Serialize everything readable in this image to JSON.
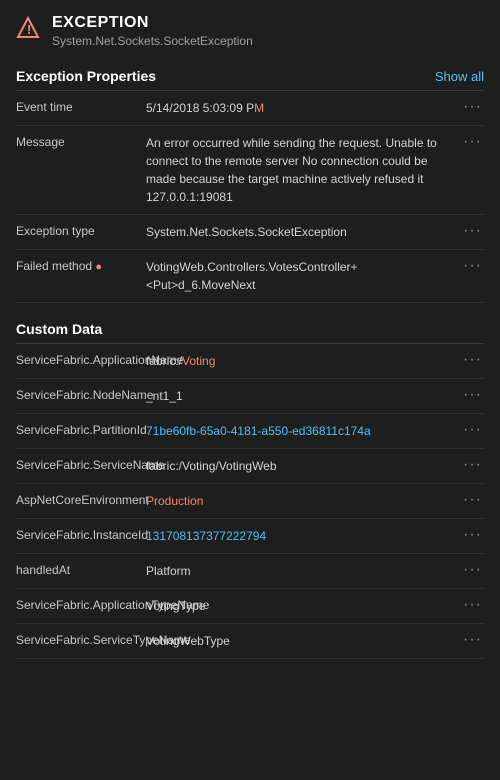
{
  "header": {
    "title": "EXCEPTION",
    "subtitle": "System.Net.Sockets.SocketException"
  },
  "exception_properties": {
    "section_title": "Exception Properties",
    "show_all_label": "Show all",
    "properties": [
      {
        "key": "Event time",
        "value": "5/14/2018 5:03:09 P",
        "highlight_suffix": "M",
        "link": false
      },
      {
        "key": "Message",
        "value": "An error occurred while sending the request. Unable to connect to the remote server No connection could be made because the target machine actively refused it 127.0.0.1:19081",
        "highlight_suffix": "",
        "link": false
      },
      {
        "key": "Exception type",
        "value": "System.Net.Sockets.SocketException",
        "highlight_suffix": "",
        "link": false
      },
      {
        "key": "Failed method",
        "value": "VotingWeb.Controllers.VotesController+<Put>d_6.MoveNext",
        "highlight_suffix": "",
        "link": false
      }
    ]
  },
  "custom_data": {
    "section_title": "Custom Data",
    "properties": [
      {
        "key": "ServiceFabric.ApplicationName",
        "value": "fabric:/Voting",
        "highlight_start": 8,
        "link": true
      },
      {
        "key": "ServiceFabric.NodeName",
        "value": "_nt1_1",
        "link": false
      },
      {
        "key": "ServiceFabric.PartitionId",
        "value": "71be60fb-65a0-4181-a550-ed36811c174a",
        "link": true
      },
      {
        "key": "ServiceFabric.ServiceName",
        "value": "fabric:/Voting/VotingWeb",
        "link": false
      },
      {
        "key": "AspNetCoreEnvironment",
        "value": "Production",
        "highlight": true,
        "link": false
      },
      {
        "key": "ServiceFabric.InstanceId",
        "value": "131708137377222794",
        "link": true
      },
      {
        "key": "handledAt",
        "value": "Platform",
        "link": false
      },
      {
        "key": "ServiceFabric.ApplicationTypeName",
        "value": "VotingType",
        "link": false
      },
      {
        "key": "ServiceFabric.ServiceTypeName",
        "value": "VotingWebType",
        "link": false
      }
    ]
  }
}
